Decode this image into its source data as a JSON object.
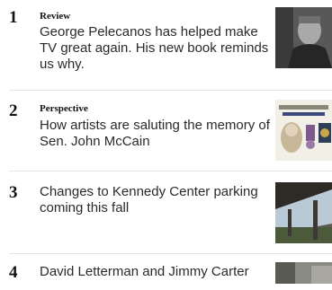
{
  "most_read": {
    "items": [
      {
        "number": "1",
        "kicker": "Review",
        "headline": "George Pelecanos has helped make TV great again. His new book reminds us why."
      },
      {
        "number": "2",
        "kicker": "Perspective",
        "headline": "How artists are saluting the memory of Sen. John McCain"
      },
      {
        "number": "3",
        "kicker": "",
        "headline": "Changes to Kennedy Center parking coming this fall"
      },
      {
        "number": "4",
        "kicker": "",
        "headline": "David Letterman and Jimmy Carter"
      }
    ]
  }
}
